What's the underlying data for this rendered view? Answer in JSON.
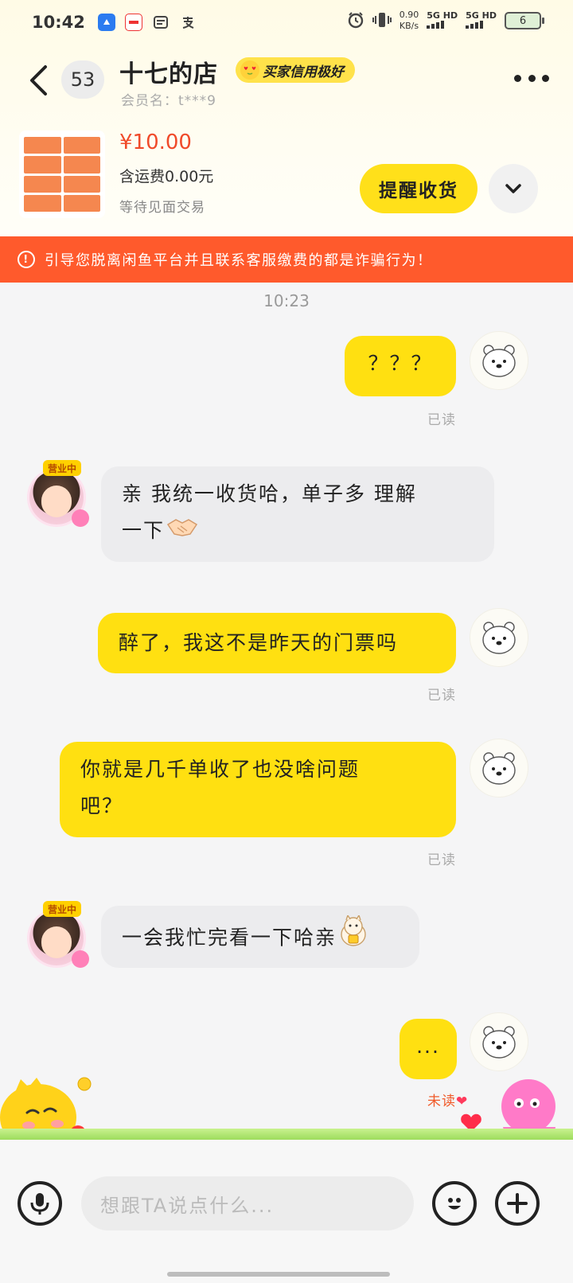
{
  "status_bar": {
    "time": "10:42",
    "net_speed_value": "0.90",
    "net_speed_unit": "KB/s",
    "signal_1": "5G HD",
    "signal_2": "5G HD",
    "battery": "6",
    "app_icons": [
      "blue-app-icon",
      "red-app-icon",
      "card-app-icon",
      "alipay-icon"
    ]
  },
  "header": {
    "back_icon": "chevron-left-icon",
    "unread_count": "53",
    "shop_name": "十七的店",
    "credit_badge": "买家信用极好",
    "member_name": "会员名：t***9",
    "more_icon": "more-dots-icon"
  },
  "product": {
    "price": "¥10.00",
    "shipping": "含运费0.00元",
    "trade_status": "等待见面交易",
    "remind_button": "提醒收货",
    "expand_icon": "chevron-down-icon"
  },
  "warning": {
    "text": "引导您脱离闲鱼平台并且联系客服缴费的都是诈骗行为！"
  },
  "chat": {
    "timestamp": "10:23",
    "messages": [
      {
        "from": "me",
        "text": "？？？",
        "status": "已读"
      },
      {
        "from": "them",
        "text_line1": "亲 我统一收货哈，单子多 理解",
        "text_line2": "一下",
        "emoji": "handshake-emoji",
        "avatar_tag": "营业中"
      },
      {
        "from": "me",
        "text": "醉了，我这不是昨天的门票吗",
        "status": "已读"
      },
      {
        "from": "me",
        "text_line1": "你就是几千单收了也没啥问题",
        "text_line2": "吧？",
        "status": "已读"
      },
      {
        "from": "them",
        "text": "一会我忙完看一下哈亲",
        "emoji": "lucky-cat-emoji",
        "avatar_tag": "营业中"
      },
      {
        "from": "me",
        "text": "...",
        "status": "未读"
      }
    ]
  },
  "input_bar": {
    "placeholder": "想跟TA说点什么...",
    "voice_icon": "microphone-icon",
    "emoji_icon": "smiley-icon",
    "add_icon": "plus-icon"
  },
  "colors": {
    "accent_yellow": "#ffe011",
    "warning_red": "#ff5a2c",
    "price_red": "#f04a2a"
  }
}
